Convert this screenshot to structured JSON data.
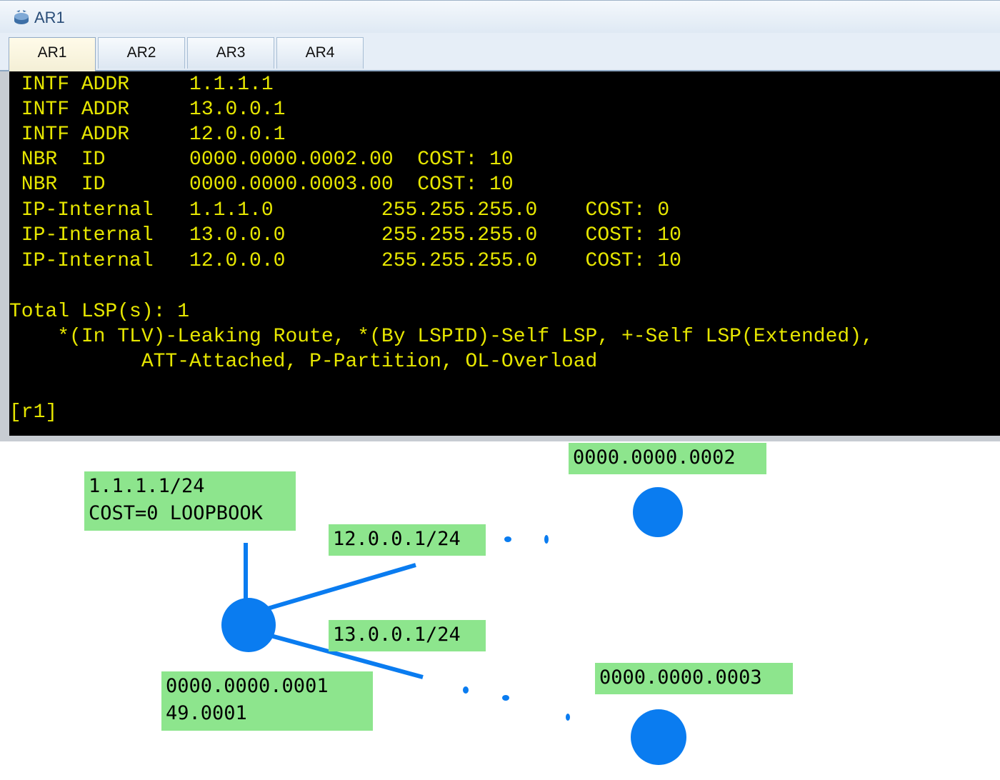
{
  "window": {
    "title": "AR1",
    "icon": "router-icon"
  },
  "tabs": [
    {
      "label": "AR1",
      "active": true
    },
    {
      "label": "AR2",
      "active": false
    },
    {
      "label": "AR3",
      "active": false
    },
    {
      "label": "AR4",
      "active": false
    }
  ],
  "terminal": {
    "text_color": "#e6e600",
    "background": "#000000",
    "lines": [
      " INTF ADDR     1.1.1.1",
      " INTF ADDR     13.0.0.1",
      " INTF ADDR     12.0.0.1",
      " NBR  ID       0000.0000.0002.00  COST: 10",
      " NBR  ID       0000.0000.0003.00  COST: 10",
      " IP-Internal   1.1.1.0         255.255.255.0    COST: 0",
      " IP-Internal   13.0.0.0        255.255.255.0    COST: 10",
      " IP-Internal   12.0.0.0        255.255.255.0    COST: 10",
      "",
      "Total LSP(s): 1",
      "    *(In TLV)-Leaking Route, *(By LSPID)-Self LSP, +-Self LSP(Extended),",
      "           ATT-Attached, P-Partition, OL-Overload",
      "",
      "[r1]"
    ]
  },
  "diagram": {
    "node_color": "#0a7cf0",
    "label_color": "#8de58d",
    "labels": {
      "loopback_line1": "1.1.1.1/24",
      "loopback_line2": "COST=0 LOOPBOOK",
      "link_12": "12.0.0.1/24",
      "link_13": "13.0.0.1/24",
      "node2_id": "0000.0000.0002",
      "node3_id": "0000.0000.0003",
      "node1_id": "0000.0000.0001",
      "node1_area": "49.0001"
    }
  }
}
